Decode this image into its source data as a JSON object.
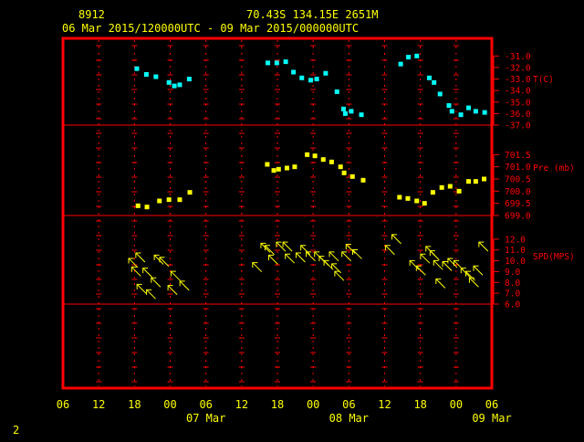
{
  "header": {
    "station_id": "8912",
    "location": "70.43S  134.15E  2651M",
    "period": "06 Mar 2015/120000UTC - 09 Mar 2015/000000UTC"
  },
  "page_number": "2",
  "colors": {
    "frame": "#ff0000",
    "text": "#ffff00",
    "temperature": "#00ffff",
    "pressure": "#ffff00",
    "wind": "#ffff00"
  },
  "x_axis": {
    "start_hour": 0,
    "end_hour": 72,
    "hour_labels": [
      "06",
      "12",
      "18",
      "00",
      "06",
      "12",
      "18",
      "00",
      "06",
      "12",
      "18",
      "00",
      "06"
    ],
    "date_labels": [
      {
        "text": "07 Mar"
      },
      {
        "text": "08 Mar"
      },
      {
        "text": "09 Mar"
      }
    ]
  },
  "chart_data": [
    {
      "type": "scatter",
      "ylabel": "T(C)",
      "ylim": [
        -37.0,
        -30.5
      ],
      "y_ticks": [
        "-31.0",
        "-32.0",
        "-33.0",
        "-34.0",
        "-35.0",
        "-36.0",
        "-37.0"
      ],
      "x_unit": "hours after 06 Mar 00UTC",
      "points": [
        {
          "x": 12.4,
          "y": -32.1
        },
        {
          "x": 14.0,
          "y": -32.6
        },
        {
          "x": 15.6,
          "y": -32.8
        },
        {
          "x": 17.8,
          "y": -33.3
        },
        {
          "x": 18.7,
          "y": -33.6
        },
        {
          "x": 19.6,
          "y": -33.5
        },
        {
          "x": 21.2,
          "y": -33.0
        },
        {
          "x": 34.4,
          "y": -31.6
        },
        {
          "x": 35.9,
          "y": -31.6
        },
        {
          "x": 37.4,
          "y": -31.5
        },
        {
          "x": 38.7,
          "y": -32.4
        },
        {
          "x": 40.1,
          "y": -32.9
        },
        {
          "x": 41.6,
          "y": -33.1
        },
        {
          "x": 42.6,
          "y": -33.0
        },
        {
          "x": 44.1,
          "y": -32.5
        },
        {
          "x": 46.0,
          "y": -34.1
        },
        {
          "x": 47.1,
          "y": -35.6
        },
        {
          "x": 47.4,
          "y": -36.0
        },
        {
          "x": 48.4,
          "y": -35.8
        },
        {
          "x": 50.1,
          "y": -36.1
        },
        {
          "x": 56.7,
          "y": -31.7
        },
        {
          "x": 58.0,
          "y": -31.1
        },
        {
          "x": 59.4,
          "y": -31.0
        },
        {
          "x": 61.5,
          "y": -32.9
        },
        {
          "x": 62.3,
          "y": -33.3
        },
        {
          "x": 63.3,
          "y": -34.3
        },
        {
          "x": 64.8,
          "y": -35.3
        },
        {
          "x": 65.3,
          "y": -35.8
        },
        {
          "x": 66.8,
          "y": -36.1
        },
        {
          "x": 68.1,
          "y": -35.5
        },
        {
          "x": 69.3,
          "y": -35.8
        },
        {
          "x": 70.8,
          "y": -35.9
        }
      ]
    },
    {
      "type": "scatter",
      "ylabel": "Pre (mb)",
      "ylim": [
        699.0,
        702.0
      ],
      "y_ticks": [
        "701.5",
        "701.0",
        "700.5",
        "700.0",
        "699.5",
        "699.0"
      ],
      "x_unit": "hours after 06 Mar 00UTC",
      "points": [
        {
          "x": 12.6,
          "y": 699.4
        },
        {
          "x": 14.1,
          "y": 699.35
        },
        {
          "x": 16.2,
          "y": 699.6
        },
        {
          "x": 17.8,
          "y": 699.65
        },
        {
          "x": 19.6,
          "y": 699.65
        },
        {
          "x": 21.3,
          "y": 699.95
        },
        {
          "x": 34.3,
          "y": 701.1
        },
        {
          "x": 35.4,
          "y": 700.85
        },
        {
          "x": 36.2,
          "y": 700.9
        },
        {
          "x": 37.6,
          "y": 700.95
        },
        {
          "x": 38.9,
          "y": 701.0
        },
        {
          "x": 41.0,
          "y": 701.5
        },
        {
          "x": 42.3,
          "y": 701.45
        },
        {
          "x": 43.7,
          "y": 701.3
        },
        {
          "x": 45.1,
          "y": 701.2
        },
        {
          "x": 46.6,
          "y": 701.0
        },
        {
          "x": 47.2,
          "y": 700.75
        },
        {
          "x": 48.6,
          "y": 700.6
        },
        {
          "x": 50.4,
          "y": 700.45
        },
        {
          "x": 56.5,
          "y": 699.75
        },
        {
          "x": 57.9,
          "y": 699.7
        },
        {
          "x": 59.4,
          "y": 699.6
        },
        {
          "x": 60.7,
          "y": 699.5
        },
        {
          "x": 62.1,
          "y": 699.95
        },
        {
          "x": 63.6,
          "y": 700.15
        },
        {
          "x": 65.0,
          "y": 700.2
        },
        {
          "x": 66.5,
          "y": 700.0
        },
        {
          "x": 68.1,
          "y": 700.4
        },
        {
          "x": 69.3,
          "y": 700.4
        },
        {
          "x": 70.7,
          "y": 700.5
        }
      ]
    },
    {
      "type": "scatter",
      "ylabel": "SPD(MPS)",
      "ylim": [
        6.0,
        13.0
      ],
      "y_ticks": [
        "12.0",
        "11.0",
        "10.0",
        "9.0",
        "8.0",
        "7.0",
        "6.0"
      ],
      "marker": "wind-direction-arrow",
      "x_unit": "hours after 06 Mar 00UTC",
      "points": [
        {
          "x": 11.8,
          "y": 9.8
        },
        {
          "x": 12.3,
          "y": 9.0
        },
        {
          "x": 13.0,
          "y": 10.3
        },
        {
          "x": 13.2,
          "y": 7.4
        },
        {
          "x": 14.2,
          "y": 8.9
        },
        {
          "x": 14.8,
          "y": 6.9
        },
        {
          "x": 15.6,
          "y": 8.0
        },
        {
          "x": 16.1,
          "y": 10.1
        },
        {
          "x": 17.0,
          "y": 9.9
        },
        {
          "x": 18.4,
          "y": 7.3
        },
        {
          "x": 18.9,
          "y": 8.6
        },
        {
          "x": 20.4,
          "y": 7.7
        },
        {
          "x": 32.6,
          "y": 9.4
        },
        {
          "x": 34.0,
          "y": 11.2
        },
        {
          "x": 34.7,
          "y": 11.0
        },
        {
          "x": 35.3,
          "y": 10.1
        },
        {
          "x": 36.6,
          "y": 11.3
        },
        {
          "x": 37.7,
          "y": 11.3
        },
        {
          "x": 38.1,
          "y": 10.2
        },
        {
          "x": 39.9,
          "y": 10.3
        },
        {
          "x": 40.7,
          "y": 11.0
        },
        {
          "x": 41.6,
          "y": 10.4
        },
        {
          "x": 43.0,
          "y": 10.4
        },
        {
          "x": 43.8,
          "y": 10.0
        },
        {
          "x": 44.6,
          "y": 9.6
        },
        {
          "x": 45.5,
          "y": 10.4
        },
        {
          "x": 45.9,
          "y": 9.3
        },
        {
          "x": 46.4,
          "y": 8.6
        },
        {
          "x": 47.6,
          "y": 10.4
        },
        {
          "x": 48.3,
          "y": 11.1
        },
        {
          "x": 49.4,
          "y": 10.6
        },
        {
          "x": 54.9,
          "y": 11.0
        },
        {
          "x": 56.0,
          "y": 12.0
        },
        {
          "x": 59.0,
          "y": 9.6
        },
        {
          "x": 60.1,
          "y": 9.1
        },
        {
          "x": 60.8,
          "y": 10.2
        },
        {
          "x": 61.7,
          "y": 10.9
        },
        {
          "x": 62.4,
          "y": 10.5
        },
        {
          "x": 63.0,
          "y": 9.6
        },
        {
          "x": 63.4,
          "y": 7.9
        },
        {
          "x": 64.5,
          "y": 9.5
        },
        {
          "x": 65.4,
          "y": 9.8
        },
        {
          "x": 66.4,
          "y": 9.6
        },
        {
          "x": 67.6,
          "y": 8.9
        },
        {
          "x": 68.4,
          "y": 8.6
        },
        {
          "x": 69.0,
          "y": 8.0
        },
        {
          "x": 69.7,
          "y": 9.1
        },
        {
          "x": 70.6,
          "y": 11.3
        }
      ]
    }
  ]
}
